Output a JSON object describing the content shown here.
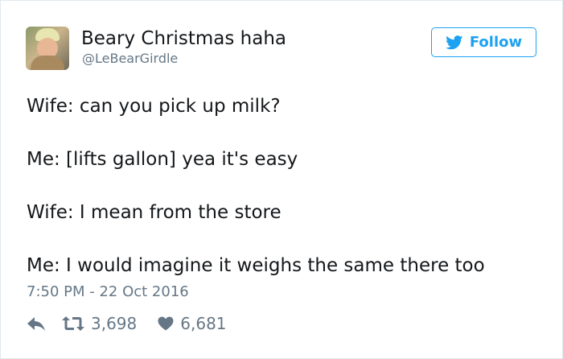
{
  "user": {
    "display_name": "Beary Christmas haha",
    "handle": "@LeBearGirdle"
  },
  "follow_button": {
    "label": "Follow",
    "color": "#1da1f2"
  },
  "tweet": {
    "lines": [
      "Wife: can you pick up milk?",
      "Me: [lifts gallon] yea it's easy",
      "Wife: I mean from the store",
      "Me: I would imagine it weighs the same there too"
    ],
    "timestamp": "7:50 PM - 22 Oct 2016"
  },
  "actions": {
    "reply_icon": "reply-icon",
    "retweet_icon": "retweet-icon",
    "retweet_count": "3,698",
    "like_icon": "heart-icon",
    "like_count": "6,681"
  }
}
